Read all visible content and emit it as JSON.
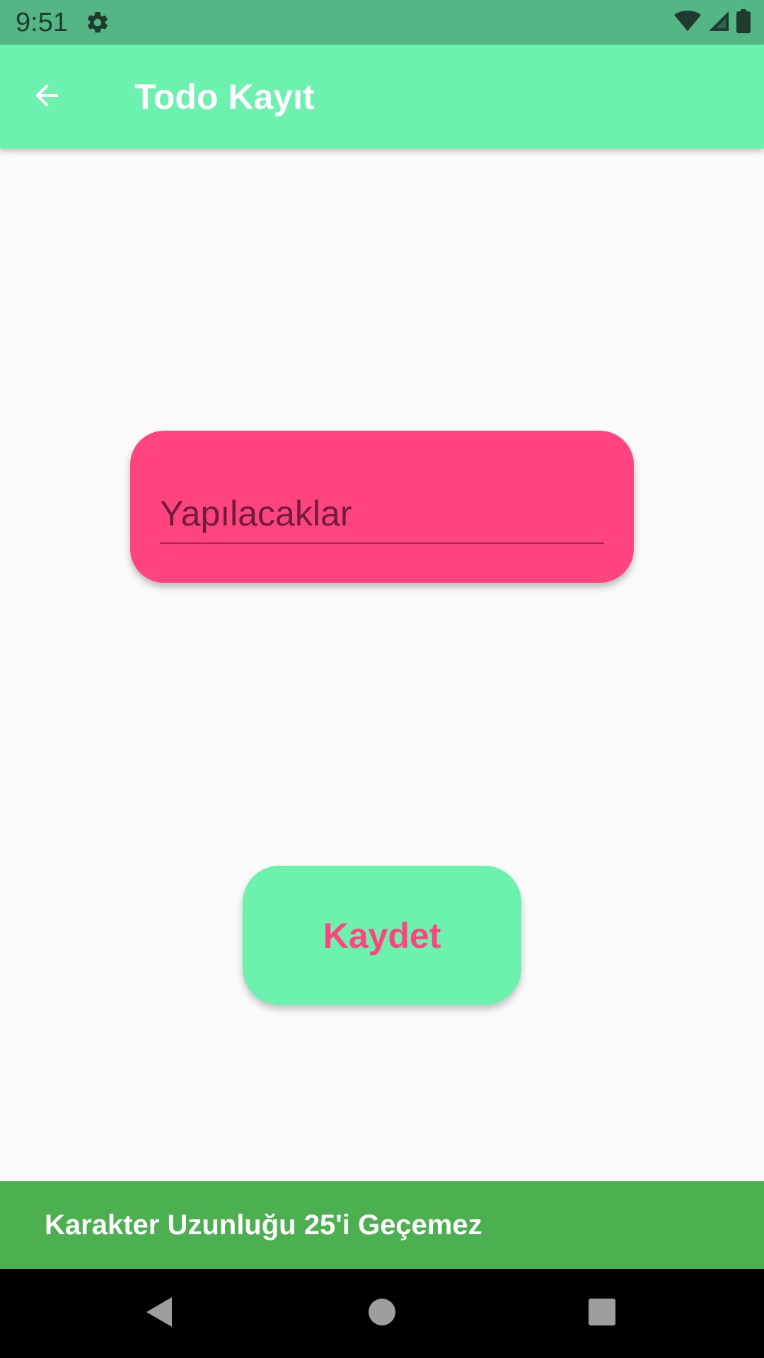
{
  "status_bar": {
    "time": "9:51",
    "icons": [
      "gear-icon",
      "wifi-icon",
      "signal-icon",
      "battery-icon"
    ]
  },
  "app_bar": {
    "back_icon": "arrow-back-icon",
    "title": "Todo Kayıt"
  },
  "form": {
    "todo_input": {
      "placeholder": "Yapılacaklar",
      "value": ""
    },
    "save_label": "Kaydet"
  },
  "snackbar": {
    "message": "Karakter Uzunluğu 25'i Geçemez"
  },
  "nav_bar": {
    "icons": [
      "back-triangle-icon",
      "home-circle-icon",
      "recents-square-icon"
    ]
  },
  "colors": {
    "status_bar": "#55b685",
    "app_bar": "#6cf2ae",
    "accent_pink": "#ff4480",
    "snackbar": "#4caf50",
    "background": "#fafafa"
  }
}
